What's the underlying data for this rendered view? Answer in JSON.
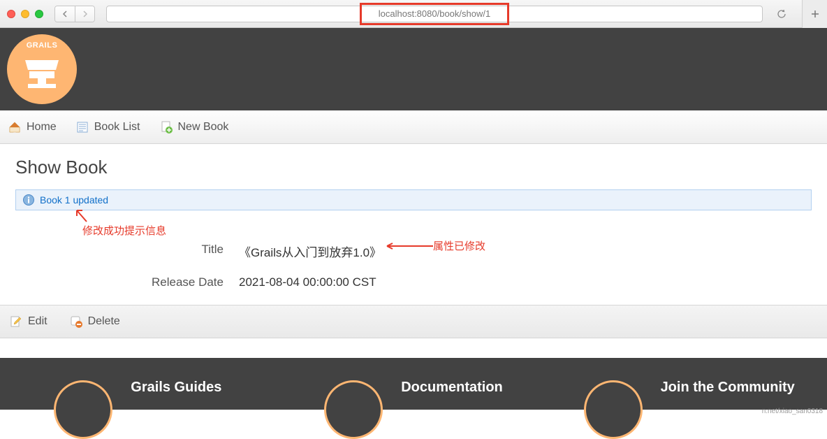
{
  "browser": {
    "url": "localhost:8080/book/show/1",
    "back_icon": "chevron-left",
    "forward_icon": "chevron-right",
    "reload_icon": "reload",
    "add_tab_icon": "plus"
  },
  "header": {
    "logo_text": "GRAILS"
  },
  "nav": {
    "items": [
      {
        "label": "Home",
        "icon": "home-icon"
      },
      {
        "label": "Book List",
        "icon": "list-icon"
      },
      {
        "label": "New Book",
        "icon": "new-icon"
      }
    ]
  },
  "page": {
    "title": "Show Book",
    "message": "Book 1 updated",
    "properties": [
      {
        "label": "Title",
        "value": "《Grails从入门到放弃1.0》"
      },
      {
        "label": "Release Date",
        "value": "2021-08-04 00:00:00 CST"
      }
    ]
  },
  "actions": {
    "edit_label": "Edit",
    "delete_label": "Delete"
  },
  "annotations": {
    "success_hint": "修改成功提示信息",
    "attr_changed": "属性已修改"
  },
  "footer": {
    "cols": [
      {
        "label": "Grails Guides"
      },
      {
        "label": "Documentation"
      },
      {
        "label": "Join the Community"
      }
    ],
    "watermark": "n.net/xiao_san0318"
  },
  "colors": {
    "accent": "#feb672",
    "annotation": "#e63a2a",
    "link": "#1170c9"
  }
}
